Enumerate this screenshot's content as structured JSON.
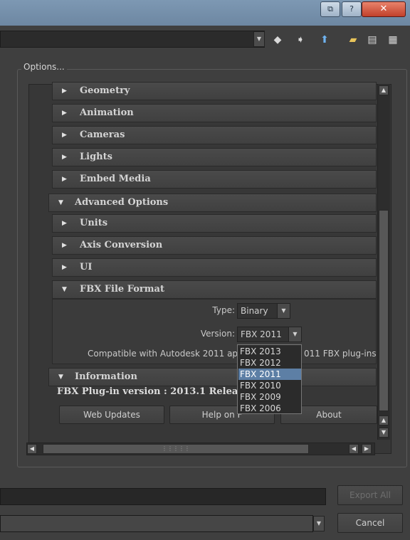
{
  "window": {
    "buttons": {
      "restore": "⧉",
      "help": "?",
      "close": "✕"
    }
  },
  "toolbar": {
    "icons": [
      "back-arrow-icon",
      "forward-arrow-icon",
      "up-arrow-icon",
      "new-folder-icon",
      "list-view-icon",
      "detail-view-icon"
    ]
  },
  "options": {
    "label": "Options...",
    "rollouts": [
      {
        "label": "Geometry",
        "state": "collapsed"
      },
      {
        "label": "Animation",
        "state": "collapsed"
      },
      {
        "label": "Cameras",
        "state": "collapsed"
      },
      {
        "label": "Lights",
        "state": "collapsed"
      },
      {
        "label": "Embed Media",
        "state": "collapsed"
      }
    ],
    "advanced": {
      "label": "Advanced Options",
      "state": "expanded",
      "children": [
        {
          "label": "Units",
          "state": "collapsed"
        },
        {
          "label": "Axis Conversion",
          "state": "collapsed"
        },
        {
          "label": "UI",
          "state": "collapsed"
        }
      ],
      "fbx_file_format": {
        "label": "FBX File Format",
        "state": "expanded",
        "type_label": "Type:",
        "type_value": "Binary",
        "version_label": "Version:",
        "version_value": "FBX 2011",
        "compat_prefix": "Compatible with Autodesk 2011 ap",
        "compat_suffix": "011 FBX plug-ins",
        "version_options": [
          "FBX 2013",
          "FBX 2012",
          "FBX 2011",
          "FBX 2010",
          "FBX 2009",
          "FBX 2006"
        ],
        "version_selected_index": 2
      }
    },
    "information": {
      "label": "Information",
      "state": "expanded",
      "plugin_version": "FBX Plug-in version : 2013.1 Releas",
      "buttons": {
        "web_updates": "Web Updates",
        "help": "Help on F",
        "about": "About"
      }
    },
    "hscroll_grip": "⋮⋮⋮⋮⋮"
  },
  "footer": {
    "export_all": "Export All",
    "cancel": "Cancel"
  }
}
